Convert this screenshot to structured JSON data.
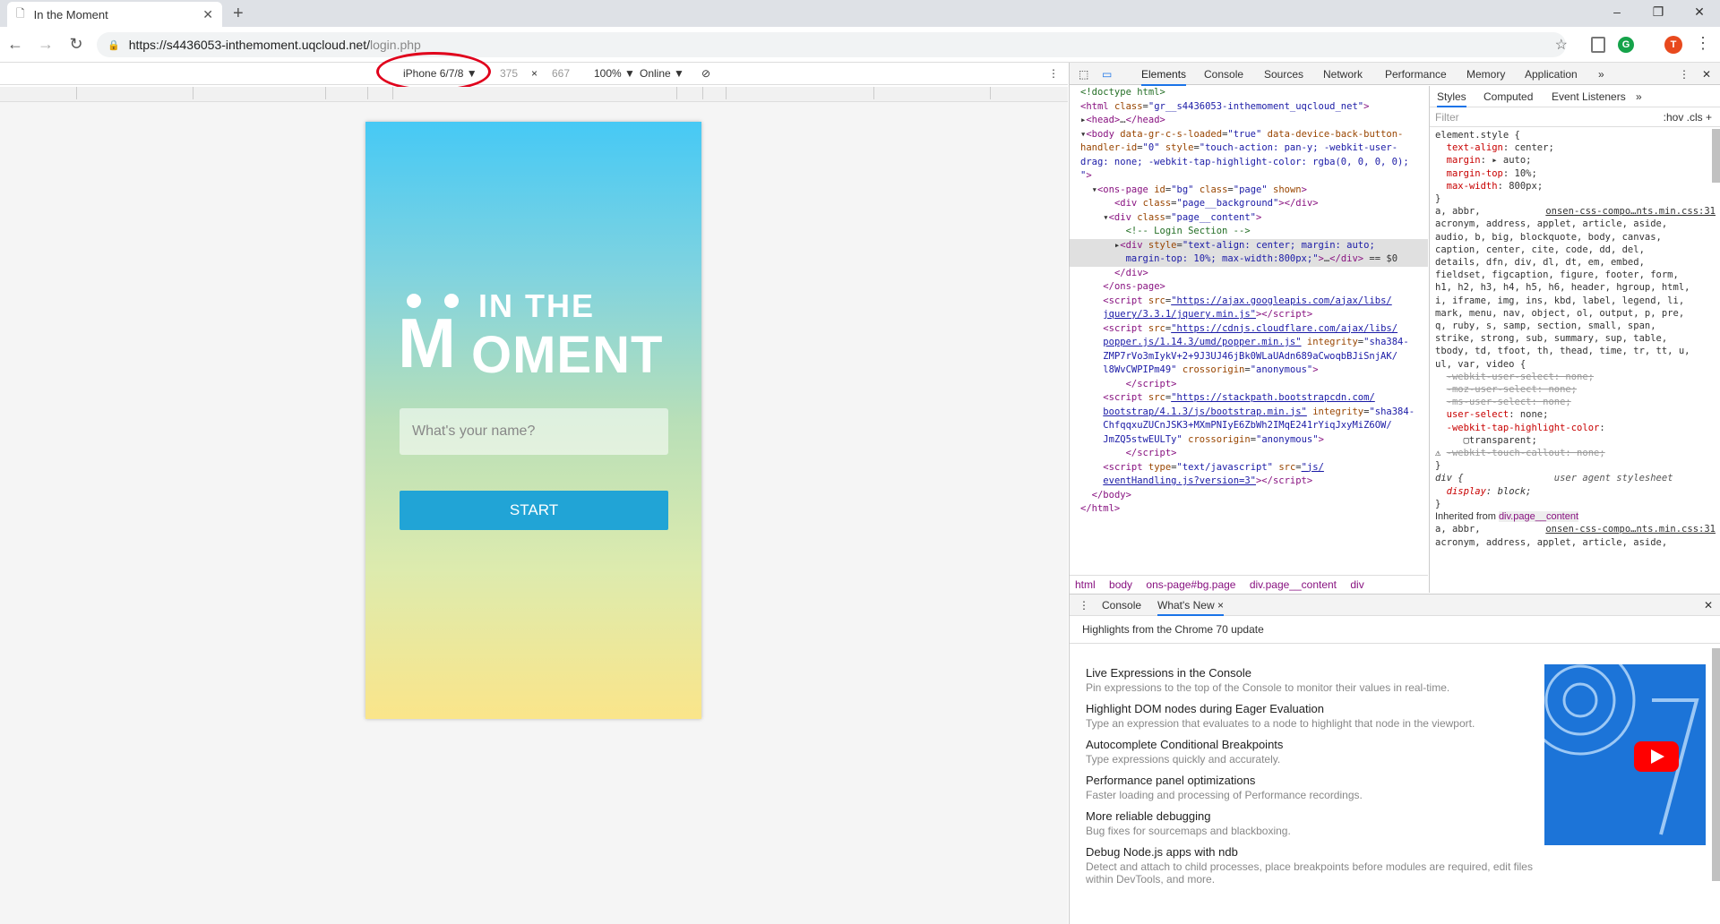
{
  "browser": {
    "tab_title": "In the Moment",
    "url_host": "https://s4436053-inthemoment.uqcloud.net/",
    "url_path": "login.php",
    "avatar_letter": "T"
  },
  "device_bar": {
    "device": "iPhone 6/7/8 ▼",
    "width": "375",
    "times": "×",
    "height": "667",
    "zoom": "100% ▼",
    "network": "Online ▼"
  },
  "app": {
    "logo_top": "IN THE",
    "logo_big_m": "M",
    "logo_rest": "OMENT",
    "name_placeholder": "What's your name?",
    "start_label": "START"
  },
  "devtools": {
    "tabs": [
      "Elements",
      "Console",
      "Sources",
      "Network",
      "Performance",
      "Memory",
      "Application",
      "»"
    ],
    "styles_tabs": [
      "Styles",
      "Computed",
      "Event Listeners",
      "»"
    ],
    "filter_placeholder": "Filter",
    "filter_right": ":hov  .cls  +",
    "breadcrumbs": [
      "html",
      "body",
      "ons-page#bg.page",
      "div.page__content",
      "div"
    ],
    "drawer_tabs": [
      "Console",
      "What's New ×"
    ],
    "highlights": "Highlights from the Chrome 70 update",
    "news": [
      {
        "title": "Live Expressions in the Console",
        "desc": "Pin expressions to the top of the Console to monitor their values in real-time."
      },
      {
        "title": "Highlight DOM nodes during Eager Evaluation",
        "desc": "Type an expression that evaluates to a node to highlight that node in the viewport."
      },
      {
        "title": "Autocomplete Conditional Breakpoints",
        "desc": "Type expressions quickly and accurately."
      },
      {
        "title": "Performance panel optimizations",
        "desc": "Faster loading and processing of Performance recordings."
      },
      {
        "title": "More reliable debugging",
        "desc": "Bug fixes for sourcemaps and blackboxing."
      },
      {
        "title": "Debug Node.js apps with ndb",
        "desc": "Detect and attach to child processes, place breakpoints before modules are required, edit files within DevTools, and more."
      }
    ],
    "inherited_from": "Inherited from",
    "inherited_class": "div.page__content"
  }
}
